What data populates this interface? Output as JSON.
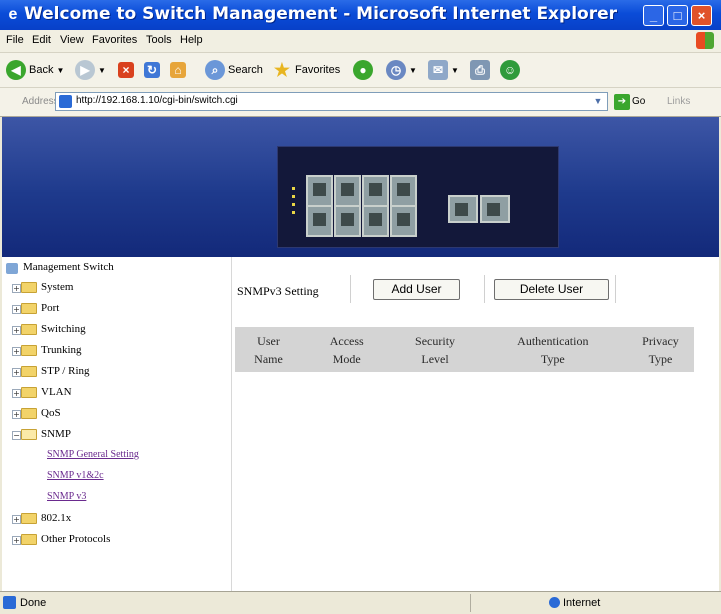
{
  "window": {
    "title": "Welcome to Switch Management - Microsoft Internet Explorer"
  },
  "menu": [
    "File",
    "Edit",
    "View",
    "Favorites",
    "Tools",
    "Help"
  ],
  "toolbar": {
    "back": "Back",
    "search": "Search",
    "favorites": "Favorites"
  },
  "address": {
    "label": "Address",
    "url": "http://192.168.1.10/cgi-bin/switch.cgi",
    "go": "Go",
    "links": "Links"
  },
  "nav": {
    "root": "Management Switch",
    "items": [
      "System",
      "Port",
      "Switching",
      "Trunking",
      "STP / Ring",
      "VLAN",
      "QoS",
      "SNMP"
    ],
    "snmp_children": [
      "SNMP General Setting",
      "SNMP v1&2c",
      "SNMP v3"
    ],
    "items_after": [
      "802.1x",
      "Other Protocols"
    ]
  },
  "content": {
    "section_label": "SNMPv3 Setting",
    "add_user": "Add User",
    "delete_user": "Delete User",
    "table_headers": [
      [
        "User",
        "Name"
      ],
      [
        "Access",
        "Mode"
      ],
      [
        "Security",
        "Level"
      ],
      [
        "Authentication",
        "Type"
      ],
      [
        "Privacy",
        "Type"
      ]
    ]
  },
  "status": {
    "text": "Done",
    "zone": "Internet"
  },
  "colors": {
    "titlebar": "#0a4cd8",
    "banner": "#1e3a8c",
    "link": "#6a2a8e",
    "table_header": "#d4d4d4"
  },
  "icons": {
    "back": "back-arrow-icon",
    "forward": "forward-arrow-icon",
    "stop": "stop-icon",
    "refresh": "refresh-icon",
    "home": "home-icon",
    "search": "search-icon",
    "favorites": "star-icon",
    "media": "media-icon",
    "history": "history-icon",
    "mail": "mail-icon",
    "print": "print-icon",
    "messenger": "messenger-icon",
    "folder": "folder-icon"
  }
}
